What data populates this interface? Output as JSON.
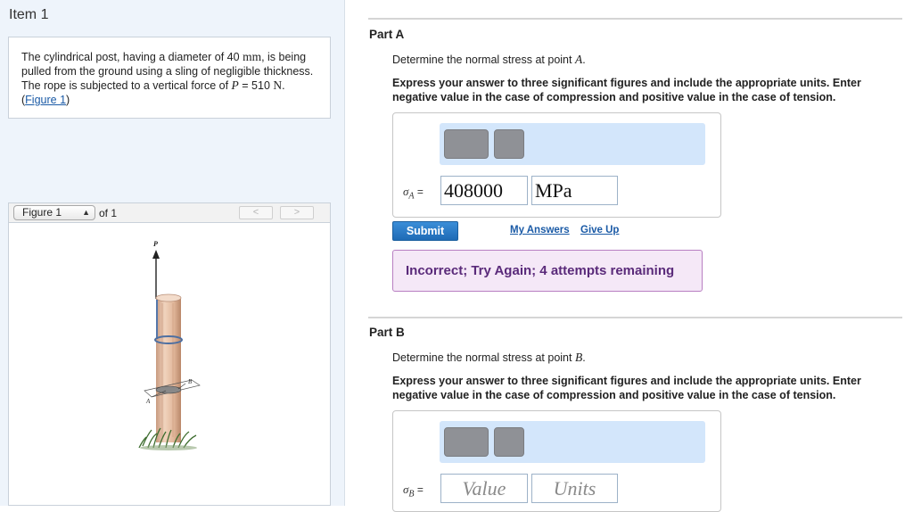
{
  "left": {
    "item_title": "Item 1",
    "problem": {
      "text_1": "The cylindrical post, having a diameter of 40",
      "unit_mm": "mm",
      "text_2": ", is being pulled from the ground using a sling of negligible thickness. The rope is subjected to a vertical force of",
      "var_p": "P",
      "eq_value": "= 510",
      "unit_n": "N",
      "dot": ". (",
      "figure_link": "Figure 1",
      "close": ")"
    },
    "figure_nav": {
      "selected": "Figure 1",
      "of_text": "of 1",
      "prev": "<",
      "next": ">"
    },
    "figure_labels": {
      "p": "P",
      "a": "A",
      "b": "B"
    }
  },
  "part_a": {
    "title": "Part A",
    "prompt_text": "Determine the normal stress at point",
    "prompt_var": "A",
    "prompt_end": ".",
    "instructions": "Express your answer to three significant figures and include the appropriate units. Enter negative value in the case of compression and positive value in the case of tension.",
    "sigma_symbol": "σ",
    "sigma_sub": "A",
    "equals": "=",
    "value": "408000",
    "units": "MPa",
    "submit_label": "Submit",
    "my_answers_label": "My Answers",
    "give_up_label": "Give Up",
    "feedback": "Incorrect; Try Again; 4 attempts remaining"
  },
  "part_b": {
    "title": "Part B",
    "prompt_text": "Determine the normal stress at point",
    "prompt_var": "B",
    "prompt_end": ".",
    "instructions": "Express your answer to three significant figures and include the appropriate units. Enter negative value in the case of compression and positive value in the case of tension.",
    "sigma_symbol": "σ",
    "sigma_sub": "B",
    "equals": "=",
    "value_placeholder": "Value",
    "units_placeholder": "Units"
  },
  "colors": {
    "left_pane_bg": "#eef4fb",
    "link": "#1a5aa6",
    "submit_bg": "#1f6bb6",
    "feedback_bg": "#f5e8f7",
    "feedback_text": "#5a2a7a",
    "toolbar_bg": "#d3e6fb"
  }
}
